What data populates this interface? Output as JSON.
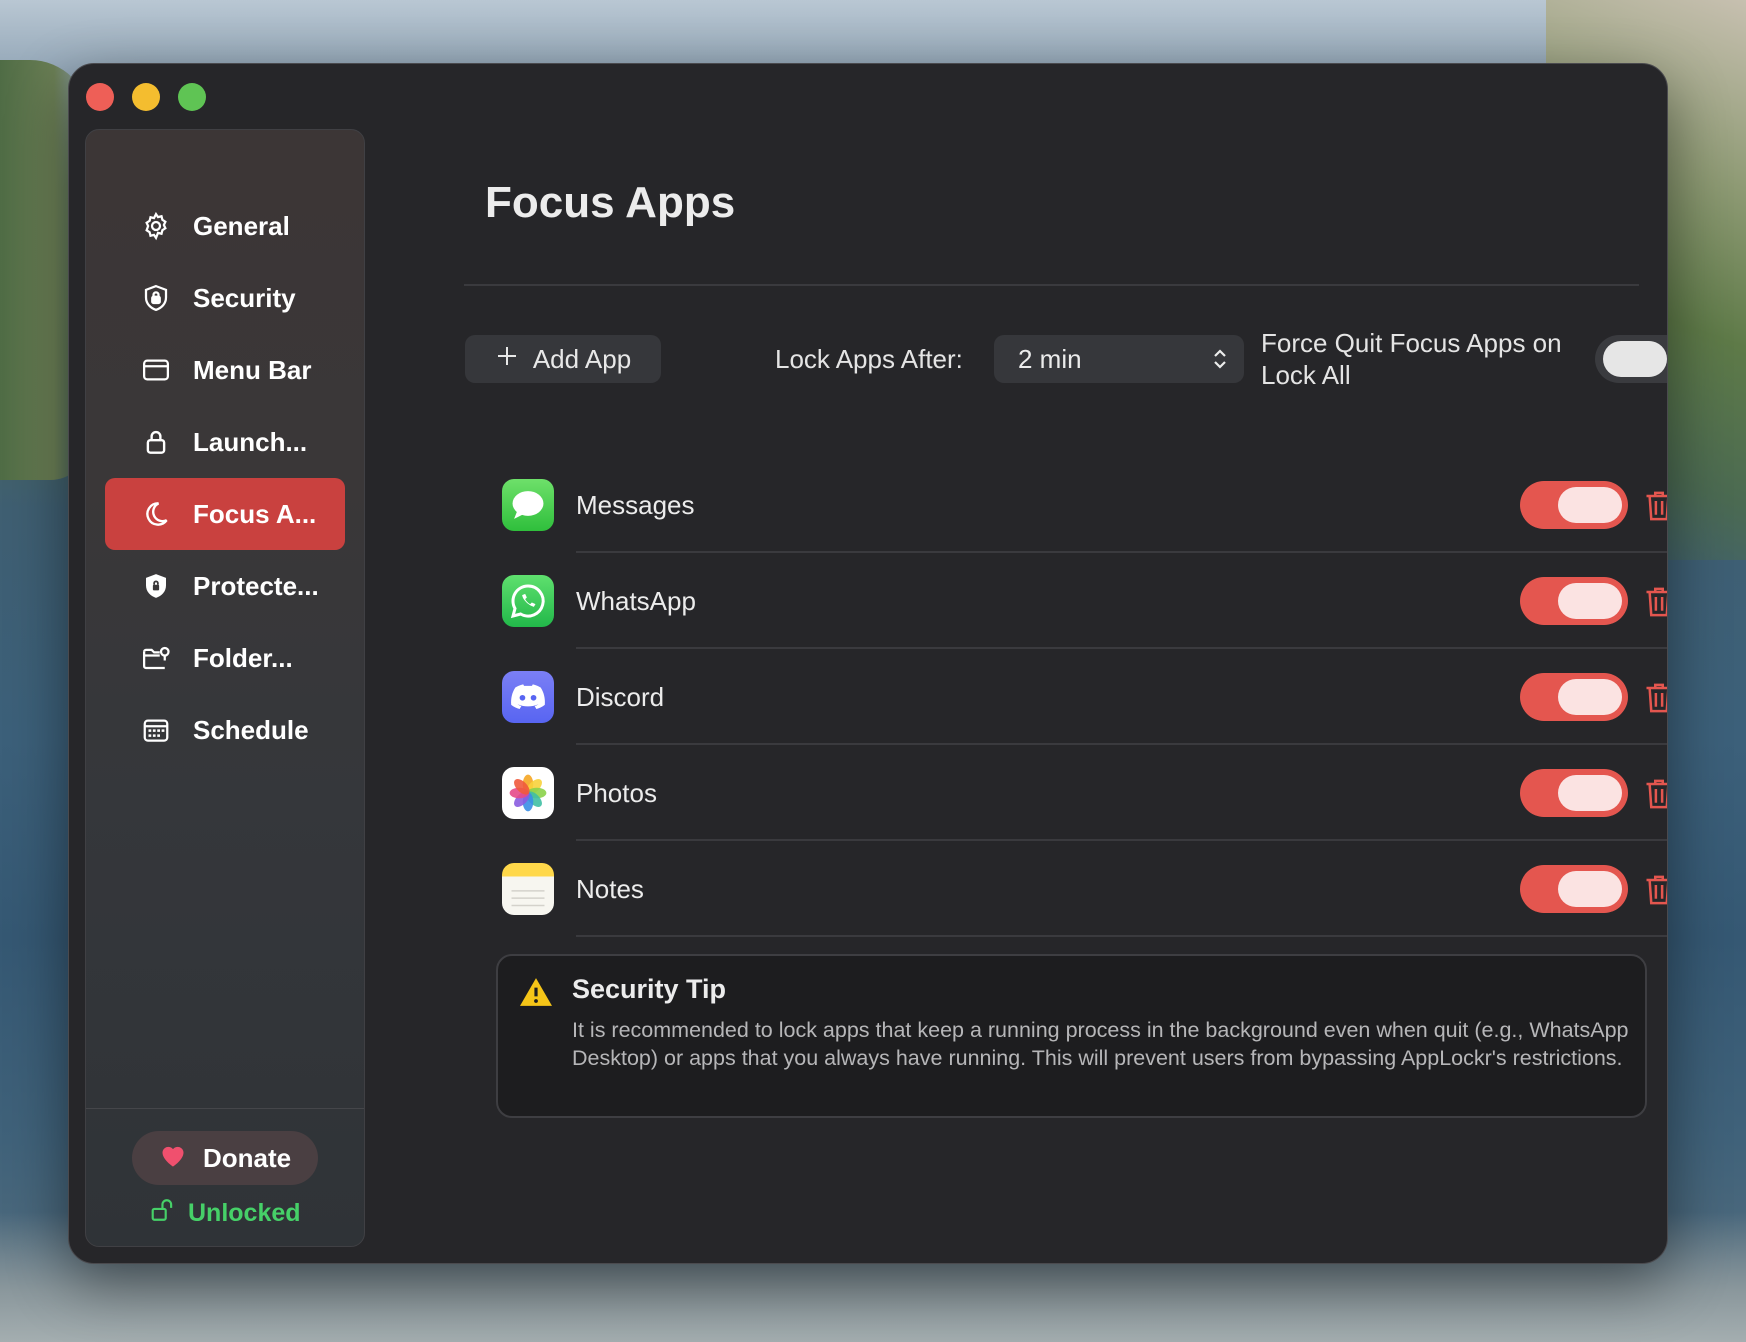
{
  "sidebar": {
    "items": [
      {
        "label": "General",
        "icon": "gear-icon"
      },
      {
        "label": "Security",
        "icon": "shield-lock-icon"
      },
      {
        "label": "Menu Bar",
        "icon": "menubar-icon"
      },
      {
        "label": "Launch...",
        "icon": "lock-icon"
      },
      {
        "label": "Focus A...",
        "icon": "moon-icon",
        "active": true
      },
      {
        "label": "Protecte...",
        "icon": "shield-icon"
      },
      {
        "label": "Folder...",
        "icon": "folder-icon"
      },
      {
        "label": "Schedule",
        "icon": "calendar-icon"
      }
    ],
    "donate_label": "Donate",
    "status_label": "Unlocked"
  },
  "main": {
    "title": "Focus Apps",
    "add_app_label": "Add App",
    "lock_after_label": "Lock Apps After:",
    "lock_after_value": "2 min",
    "force_quit_label": "Force Quit Focus Apps on Lock All",
    "force_quit_enabled": false
  },
  "apps": [
    {
      "name": "Messages",
      "enabled": true
    },
    {
      "name": "WhatsApp",
      "enabled": true
    },
    {
      "name": "Discord",
      "enabled": true
    },
    {
      "name": "Photos",
      "enabled": true
    },
    {
      "name": "Notes",
      "enabled": true
    }
  ],
  "tip": {
    "title": "Security Tip",
    "body": "It is recommended to lock apps that keep a running process in the background even when quit (e.g., WhatsApp Desktop) or apps that you always have running. This will prevent users from bypassing AppLockr's restrictions."
  },
  "colors": {
    "accent": "#c9413f",
    "toggle_on": "#e4564f",
    "unlocked": "#46d068",
    "info": "#3d8bf0",
    "warning": "#f5c518"
  }
}
